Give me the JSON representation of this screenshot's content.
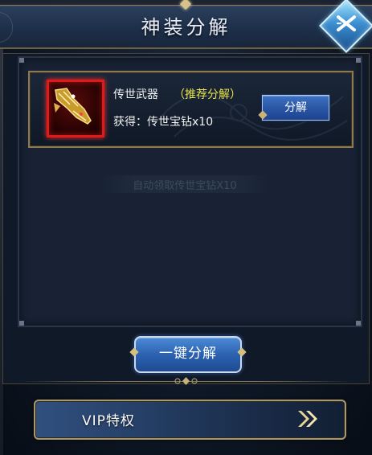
{
  "header": {
    "title": "神装分解",
    "close_icon": "close-icon"
  },
  "item": {
    "name": "传世武器",
    "tag": "（推荐分解）",
    "gain": "获得：传世宝钻x10",
    "decompose_label": "分解",
    "icon": "weapon-icon",
    "frame_color": "#e01919",
    "tag_color": "#e9e24a"
  },
  "auto_claim_text": "自动领取传世宝钻X10",
  "actions": {
    "one_key_label": "一键分解"
  },
  "vip": {
    "label": "VIP特权",
    "arrow_icon": "double-chevron-right-icon"
  },
  "colors": {
    "gold_border": "#8d7a4e",
    "button_blue": "#2c62b0",
    "panel_bg": "#182234"
  }
}
